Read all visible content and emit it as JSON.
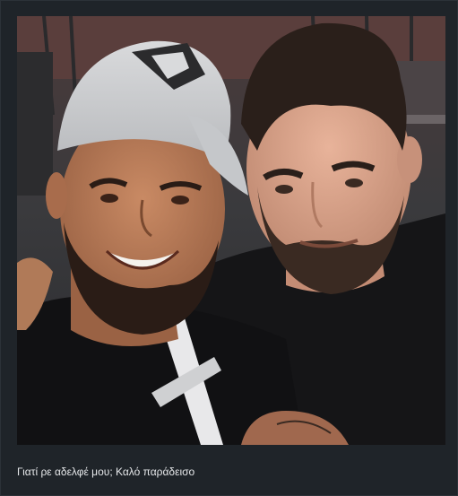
{
  "post": {
    "photo_alt": "",
    "caption": "Γιατί ρε αδελφέ μου; Καλό παράδεισο"
  }
}
